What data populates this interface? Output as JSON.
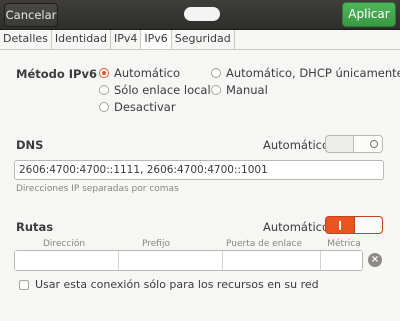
{
  "header": {
    "cancel_label": "Cancelar",
    "apply_label": "Aplicar"
  },
  "tabs": [
    {
      "label": "Detalles"
    },
    {
      "label": "Identidad"
    },
    {
      "label": "IPv4"
    },
    {
      "label": "IPv6",
      "active": true
    },
    {
      "label": "Seguridad"
    }
  ],
  "ipv6": {
    "method_label": "Método IPv6",
    "options": {
      "automatico": {
        "label": "Automático",
        "checked": true
      },
      "auto_dhcp": {
        "label": "Automático, DHCP únicamente",
        "checked": false
      },
      "enlace_local": {
        "label": "Sólo enlace local",
        "checked": false
      },
      "manual": {
        "label": "Manual",
        "checked": false
      },
      "desactivar": {
        "label": "Desactivar",
        "checked": false
      }
    }
  },
  "dns": {
    "label": "DNS",
    "auto_label": "Automático",
    "auto_switch_on": false,
    "value": "2606:4700:4700::1111, 2606:4700:4700::1001",
    "hint": "Direcciones IP separadas por comas"
  },
  "routes": {
    "label": "Rutas",
    "auto_label": "Automático",
    "auto_switch_on": true,
    "columns": {
      "address": "Dirección",
      "prefix": "Prefijo",
      "gateway": "Puerta de enlace",
      "metric": "Métrica"
    },
    "only_local_label": "Usar esta conexión sólo para los recursos en su red",
    "only_local_checked": false
  },
  "colors": {
    "accent": "#e95420",
    "apply_green": "#3a9a44",
    "headerbar": "#2f2e2b"
  },
  "icons": {
    "clear": "clear-icon"
  }
}
